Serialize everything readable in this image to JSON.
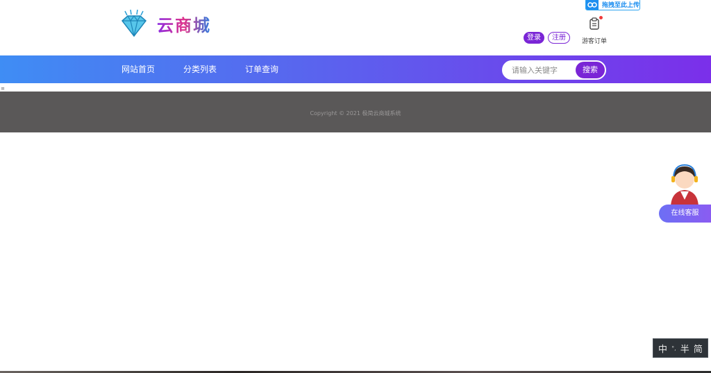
{
  "header": {
    "logo_text": "云商城",
    "upload_badge": "拖拽至此上传",
    "login_label": "登录",
    "register_label": "注册",
    "guest_orders_label": "游客订单"
  },
  "nav": {
    "items": [
      {
        "label": "网站首页"
      },
      {
        "label": "分类列表"
      },
      {
        "label": "订单查询"
      }
    ],
    "search_placeholder": "请输入关键字",
    "search_button": "搜索"
  },
  "tiny_mark": "=",
  "footer": {
    "copyright": "Copyright © 2021 极简云商城系统"
  },
  "service": {
    "label": "在线客服"
  },
  "ime": {
    "lang": "中",
    "punct": "°,",
    "width": "半",
    "script": "简"
  },
  "colors": {
    "nav_gradient_start": "#3f8df4",
    "nav_gradient_end": "#7b2fea",
    "accent_purple": "#7a25d6",
    "footer_bg": "#5a5858"
  }
}
